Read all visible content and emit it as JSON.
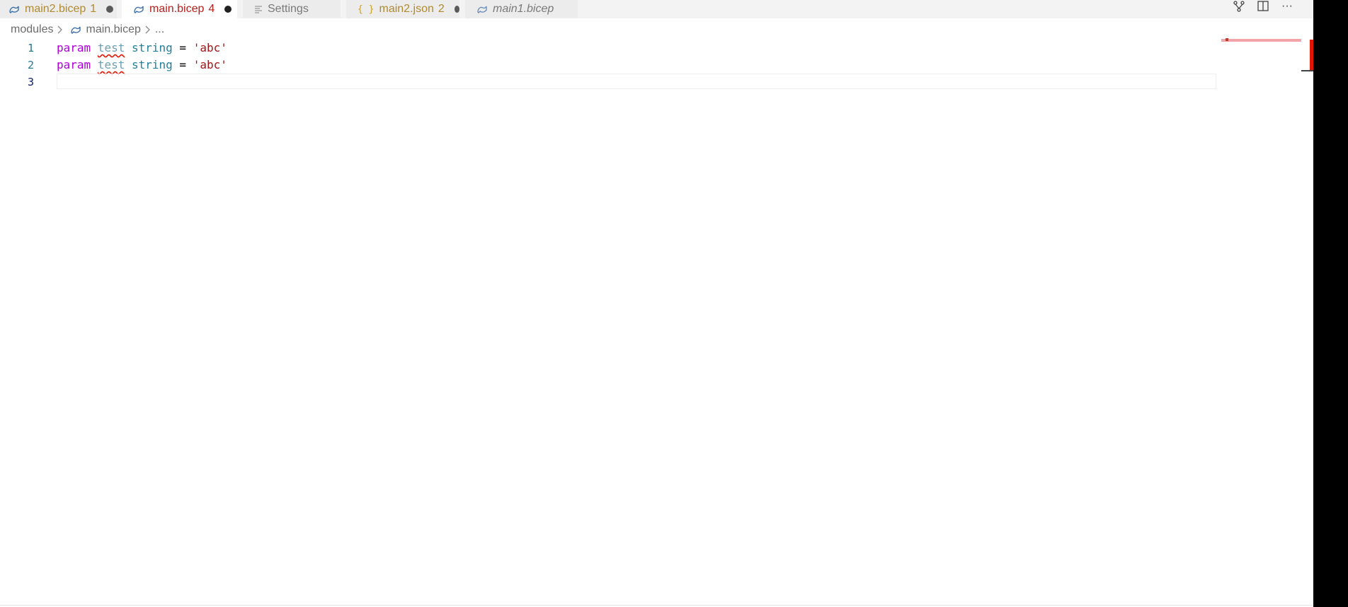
{
  "tabs": [
    {
      "label": "main2.bicep",
      "count": "1",
      "dirty": true,
      "icon": "bicep-icon",
      "color": "#b08a2e",
      "active": false
    },
    {
      "label": "main.bicep",
      "count": "4",
      "dirty": true,
      "icon": "bicep-icon",
      "color": "#b5211d",
      "active": true
    },
    {
      "label": "Settings",
      "count": "",
      "dirty": false,
      "icon": "settings-file-icon",
      "color": "#7a7a7a",
      "active": false
    },
    {
      "label": "main2.json",
      "count": "2",
      "dirty": true,
      "icon": "json-icon",
      "color": "#b08a2e",
      "active": false
    },
    {
      "label": "main1.bicep",
      "count": "",
      "dirty": false,
      "icon": "bicep-icon",
      "color": "#7a7a7a",
      "active": false
    }
  ],
  "breadcrumb": {
    "folder": "modules",
    "file": "main.bicep",
    "more": "..."
  },
  "editor": {
    "lines": [
      {
        "number": "1",
        "keyword": "param",
        "name": "test",
        "type": "string",
        "op": "=",
        "value": "'abc'"
      },
      {
        "number": "2",
        "keyword": "param",
        "name": "test",
        "type": "string",
        "op": "=",
        "value": "'abc'"
      },
      {
        "number": "3"
      }
    ]
  },
  "actions": [
    {
      "icon": "compare-changes-icon"
    },
    {
      "icon": "split-editor-icon"
    },
    {
      "icon": "more-actions-icon",
      "label": "···"
    }
  ],
  "colors": {
    "accent": "#b5211d",
    "error": "#e51400",
    "keyword": "#af00db",
    "type": "#267f99",
    "string": "#a31515"
  }
}
